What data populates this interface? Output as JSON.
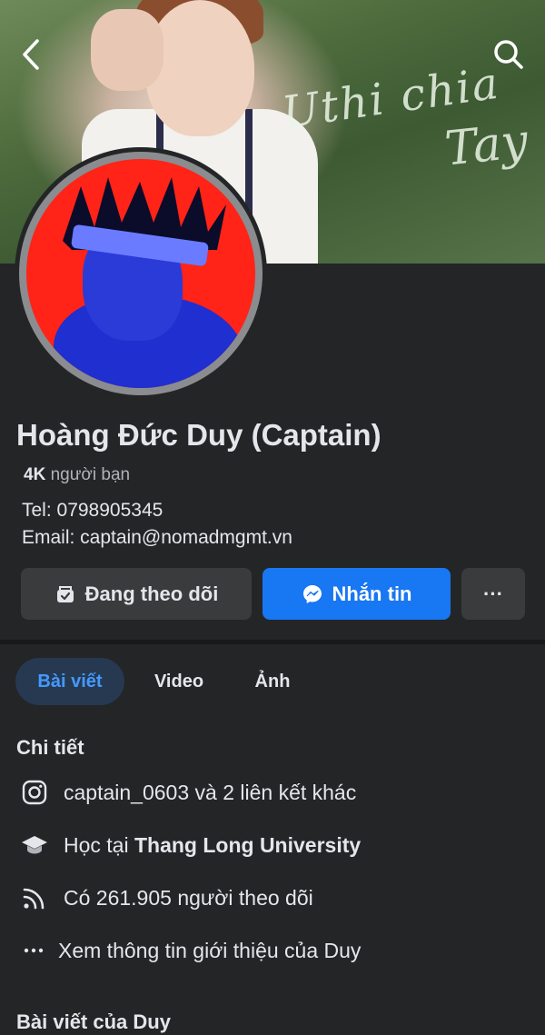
{
  "cover": {
    "script_line1": "Uthi chia",
    "script_line2": "Tay"
  },
  "header": {
    "back_icon": "chevron-left-icon",
    "search_icon": "search-icon"
  },
  "profile": {
    "name": "Hoàng Đức Duy (Captain)",
    "friends_count": "4K",
    "friends_label": "người bạn",
    "tel": "Tel: 0798905345",
    "email": "Email: captain@nomadmgmt.vn"
  },
  "actions": {
    "follow_label": "Đang theo dõi",
    "message_label": "Nhắn tin",
    "more_label": "···"
  },
  "tabs": [
    {
      "label": "Bài viết",
      "active": true
    },
    {
      "label": "Video",
      "active": false
    },
    {
      "label": "Ảnh",
      "active": false
    }
  ],
  "details": {
    "title": "Chi tiết",
    "instagram": "captain_0603 và 2 liên kết khác",
    "study_prefix": "Học tại ",
    "study_school": "Thang Long University",
    "followers": "Có 261.905 người theo dõi",
    "more_info": "Xem thông tin giới thiệu của Duy"
  },
  "posts": {
    "title": "Bài viết của Duy"
  },
  "colors": {
    "background": "#242526",
    "accent": "#1877f2",
    "tab_active_text": "#4599ff"
  }
}
